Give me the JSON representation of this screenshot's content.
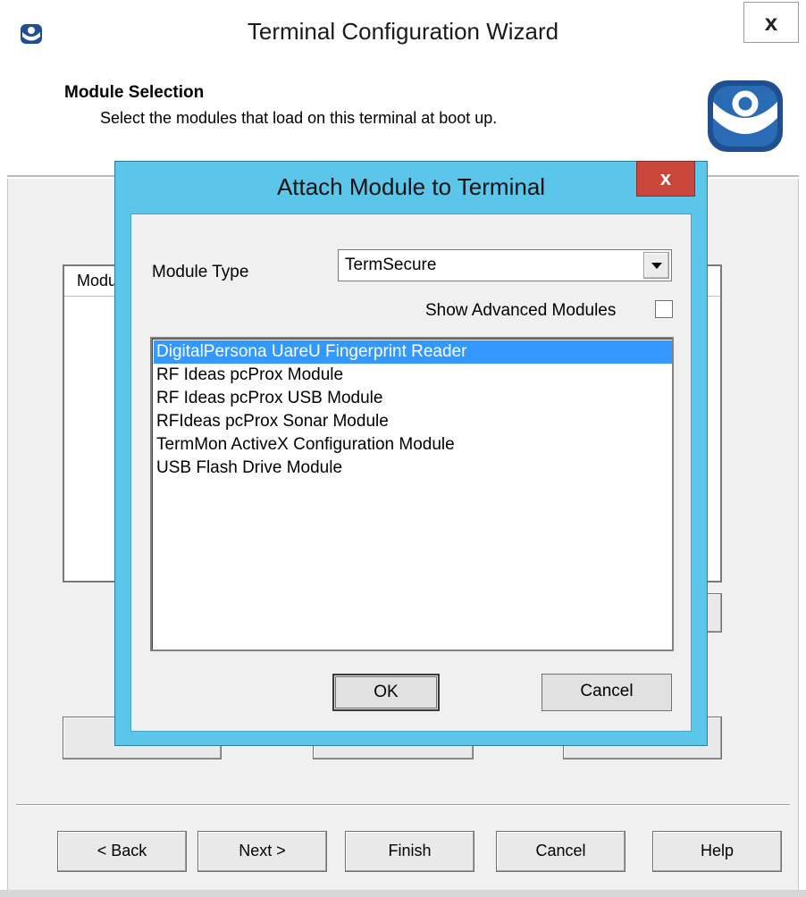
{
  "wizard": {
    "title": "Terminal Configuration Wizard",
    "close_label": "x",
    "header_title": "Module Selection",
    "header_subtitle": "Select the modules that load on this terminal at boot up.",
    "list_header": "Modu",
    "buttons": {
      "back": "< Back",
      "next": "Next >",
      "finish": "Finish",
      "cancel": "Cancel",
      "help": "Help"
    }
  },
  "dialog": {
    "title": "Attach Module to Terminal",
    "close_label": "x",
    "module_type_label": "Module Type",
    "module_type_value": "TermSecure",
    "show_advanced_label": "Show Advanced Modules",
    "show_advanced_checked": false,
    "modules": [
      "DigitalPersona UareU Fingerprint Reader",
      "RF Ideas pcProx Module",
      "RF Ideas pcProx USB Module",
      "RFIdeas pcProx Sonar Module",
      "TermMon ActiveX Configuration Module",
      "USB Flash Drive Module"
    ],
    "selected_module": "DigitalPersona UareU Fingerprint Reader",
    "ok_label": "OK",
    "cancel_label": "Cancel"
  },
  "colors": {
    "dialog_frame": "#5bc5ea",
    "close_button": "#c8463a",
    "selection": "#3399ff"
  },
  "icons": {
    "app": "thinmanager-icon",
    "logo": "thinmanager-logo",
    "dropdown": "chevron-down-icon"
  }
}
